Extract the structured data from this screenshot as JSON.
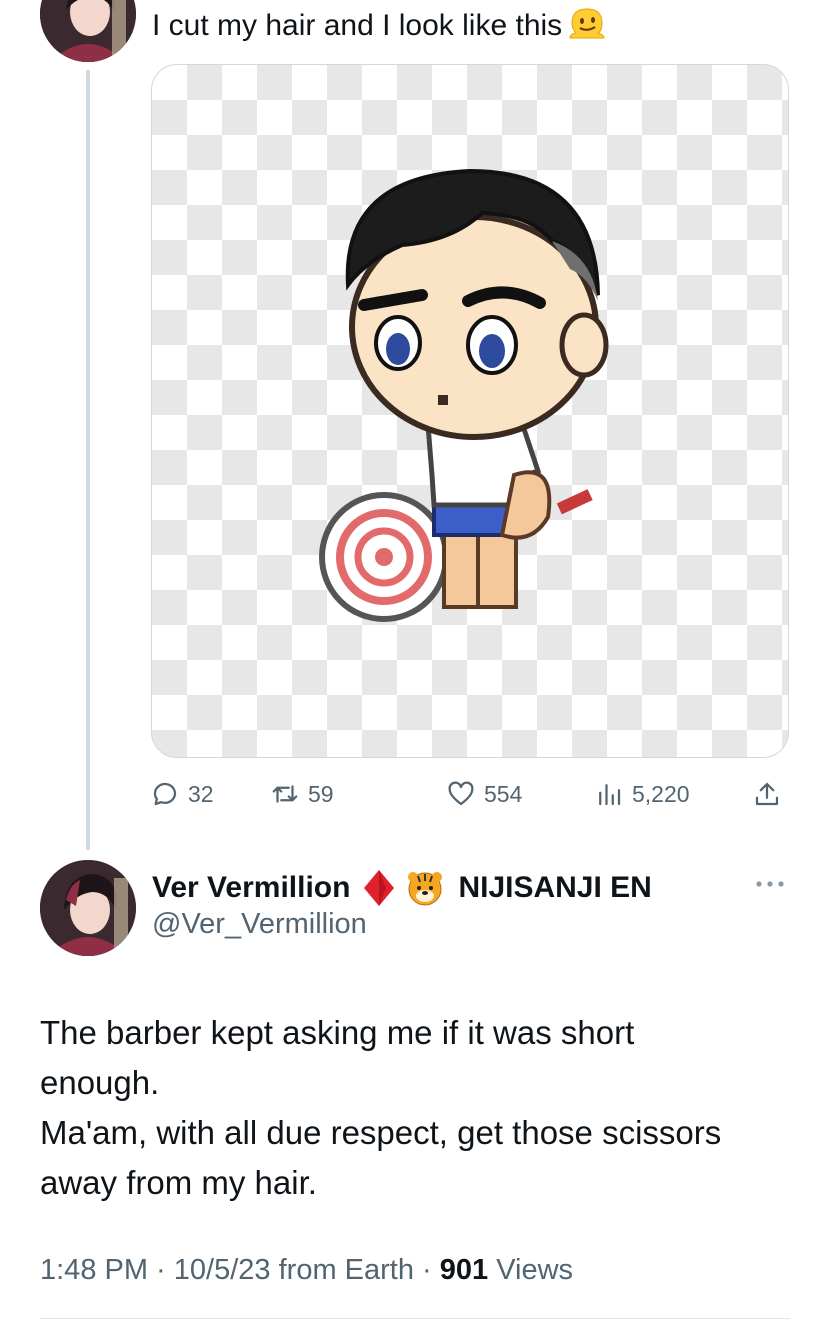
{
  "previous_tweet": {
    "text": "I cut my hair and I look like this",
    "emoji": "melting-face",
    "stats": {
      "replies": "32",
      "reposts": "59",
      "likes": "554",
      "views": "5,220"
    }
  },
  "main_tweet": {
    "display_name": "Ver Vermillion",
    "affiliation": "NIJISANJI EN",
    "handle": "@Ver_Vermillion",
    "body_lines": [
      "The barber kept asking me if it was short",
      "enough.",
      "Ma'am, with all due respect, get those scissors",
      "away from my hair."
    ],
    "time": "1:48 PM",
    "date": "10/5/23",
    "source": "from Earth",
    "views_count": "901",
    "views_label": "Views"
  },
  "colors": {
    "text": "#0f1419",
    "secondary": "#536471",
    "thread_line": "#cfd9de",
    "badge_red": "#e0202a"
  }
}
